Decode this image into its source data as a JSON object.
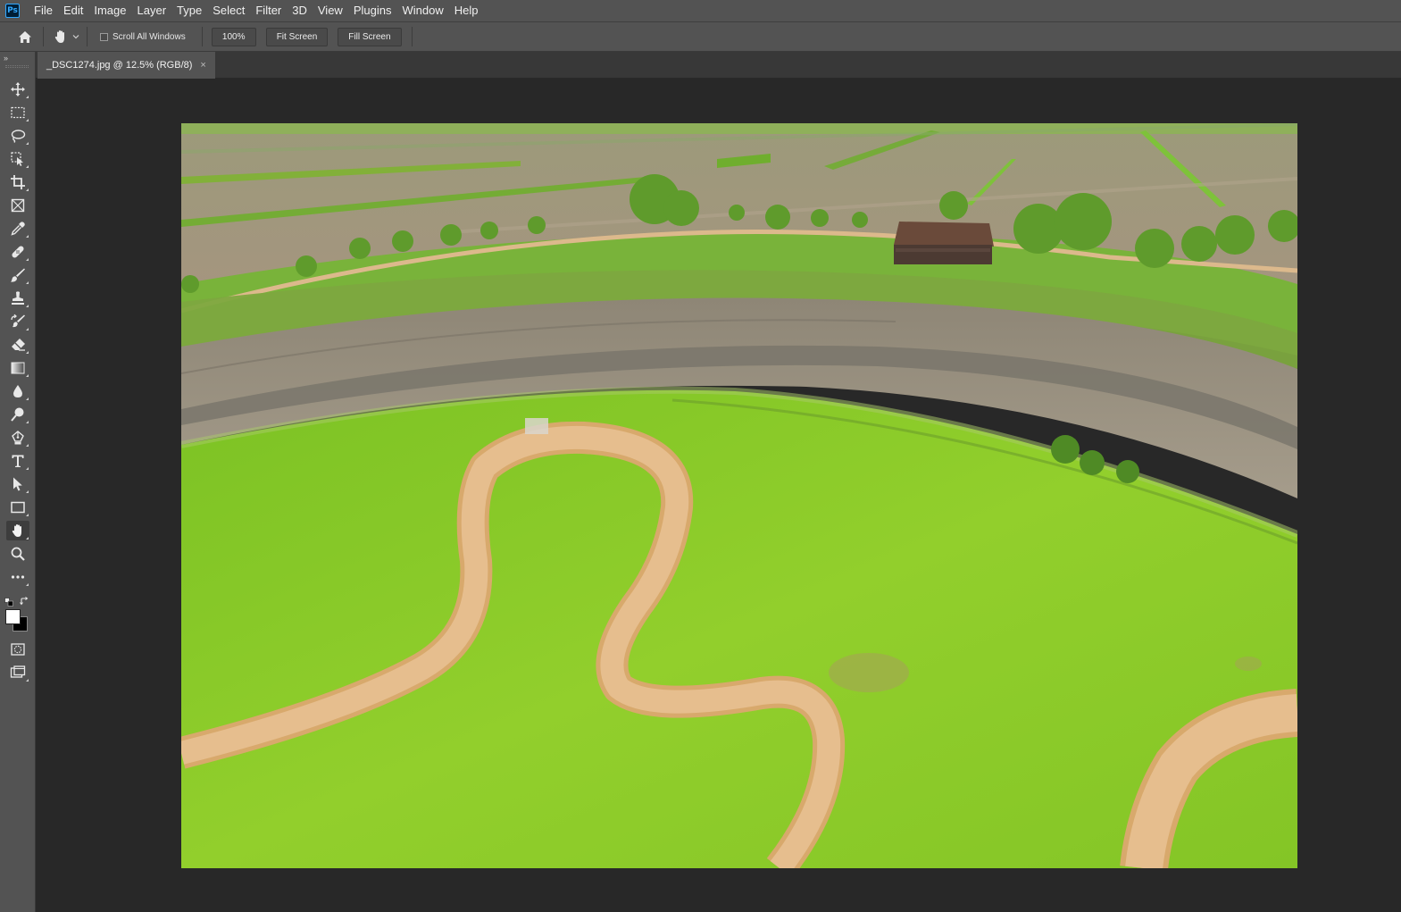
{
  "app": {
    "logo_text": "Ps"
  },
  "menu": {
    "items": [
      {
        "label": "File"
      },
      {
        "label": "Edit"
      },
      {
        "label": "Image"
      },
      {
        "label": "Layer"
      },
      {
        "label": "Type"
      },
      {
        "label": "Select"
      },
      {
        "label": "Filter"
      },
      {
        "label": "3D"
      },
      {
        "label": "View"
      },
      {
        "label": "Plugins"
      },
      {
        "label": "Window"
      },
      {
        "label": "Help"
      }
    ]
  },
  "options_bar": {
    "scroll_all_windows_label": "Scroll All Windows",
    "scroll_all_windows_checked": false,
    "zoom_label": "100%",
    "fit_screen_label": "Fit Screen",
    "fill_screen_label": "Fill Screen"
  },
  "document": {
    "tab_title": "_DSC1274.jpg @ 12.5% (RGB/8)",
    "close_glyph": "×"
  },
  "toolbar": {
    "collapse_glyph": "»",
    "active_tool": "hand-tool",
    "tools": [
      "move-tool",
      "rectangular-marquee-tool",
      "lasso-tool",
      "object-selection-tool",
      "crop-tool",
      "frame-tool",
      "eyedropper-tool",
      "spot-healing-brush-tool",
      "brush-tool",
      "clone-stamp-tool",
      "history-brush-tool",
      "eraser-tool",
      "gradient-tool",
      "blur-tool",
      "dodge-tool",
      "pen-tool",
      "type-tool",
      "path-selection-tool",
      "rectangle-tool",
      "hand-tool",
      "zoom-tool",
      "edit-toolbar"
    ]
  },
  "colors": {
    "foreground": "#ffffff",
    "background": "#000000",
    "grass": "#8fcd2c",
    "path": "#e2b98a",
    "mud": "#948a78",
    "field": "#a99a80"
  }
}
